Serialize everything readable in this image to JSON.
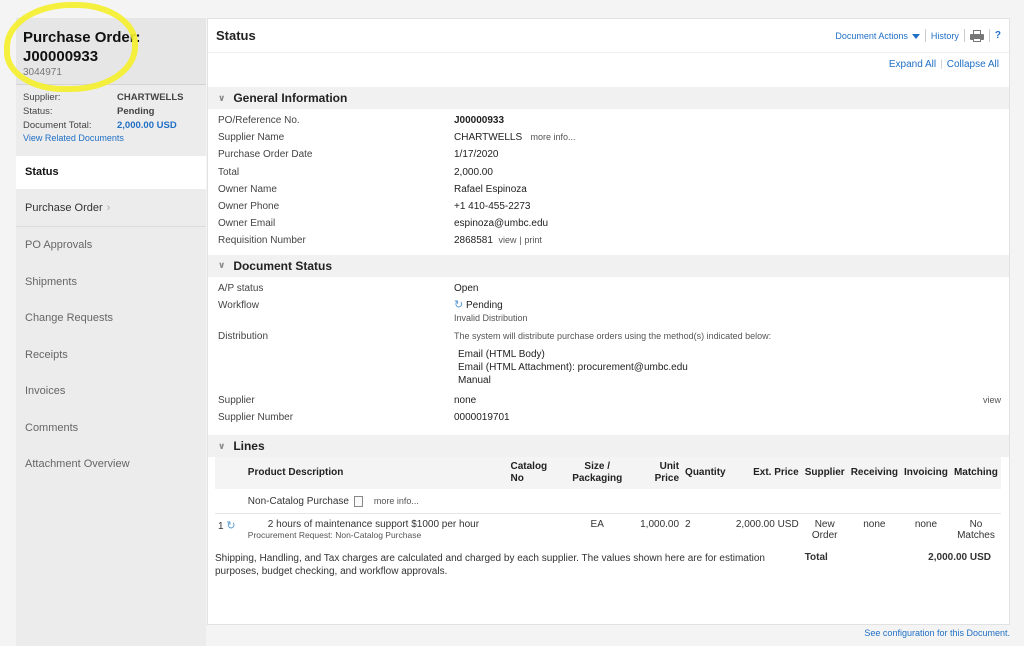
{
  "sidebar": {
    "title_line1": "Purchase Order:",
    "title_line2": "J00000933",
    "sub_id": "3044971",
    "meta": [
      {
        "key": "Supplier:",
        "value": "CHARTWELLS"
      },
      {
        "key": "Status:",
        "value": "Pending"
      },
      {
        "key": "Document Total:",
        "value": "2,000.00  USD"
      }
    ],
    "related_link": "View Related Documents",
    "nav": [
      {
        "label": "Status"
      },
      {
        "label": "Purchase Order"
      },
      {
        "label": "PO Approvals"
      },
      {
        "label": "Shipments"
      },
      {
        "label": "Change Requests"
      },
      {
        "label": "Receipts"
      },
      {
        "label": "Invoices"
      },
      {
        "label": "Comments"
      },
      {
        "label": "Attachment Overview"
      }
    ]
  },
  "header": {
    "title": "Status",
    "document_actions": "Document Actions",
    "history": "History",
    "help": "?",
    "expand_all": "Expand All",
    "collapse_all": "Collapse All"
  },
  "general": {
    "title": "General Information",
    "rows": [
      {
        "key": "PO/Reference No.",
        "value": "J00000933"
      },
      {
        "key": "Supplier Name",
        "value": "CHARTWELLS",
        "link": "more info..."
      },
      {
        "key": "Purchase Order Date",
        "value": "1/17/2020"
      },
      {
        "key": "Total",
        "value": "2,000.00"
      },
      {
        "key": "Owner Name",
        "value": "Rafael Espinoza"
      },
      {
        "key": "Owner Phone",
        "value": "+1 410-455-2273"
      },
      {
        "key": "Owner Email",
        "value": "espinoza@umbc.edu"
      },
      {
        "key": "Requisition Number",
        "value": "2868581",
        "link": "view",
        "link2": "print"
      }
    ]
  },
  "docstatus": {
    "title": "Document Status",
    "ap_key": "A/P status",
    "ap_value": "Open",
    "workflow_key": "Workflow",
    "workflow_value": "Pending",
    "workflow_note": "Invalid Distribution",
    "distribution_key": "Distribution",
    "distribution_intro": "The system will distribute purchase orders using the method(s) indicated below:",
    "distribution_methods": [
      "Email (HTML Body)",
      "Email (HTML Attachment): procurement@umbc.edu",
      "Manual"
    ],
    "supplier_key": "Supplier",
    "supplier_value": "none",
    "supplier_link": "view",
    "supplier_number_key": "Supplier Number",
    "supplier_number_value": "0000019701"
  },
  "lines": {
    "title": "Lines",
    "headers": {
      "product": "Product Description",
      "catalog": "Catalog No",
      "size": "Size / Packaging",
      "unit_price": "Unit Price",
      "quantity": "Quantity",
      "ext_price": "Ext. Price",
      "supplier": "Supplier",
      "receiving": "Receiving",
      "invoicing": "Invoicing",
      "matching": "Matching"
    },
    "group_label": "Non-Catalog Purchase",
    "group_link": "more info...",
    "row": {
      "num": "1",
      "description": "2 hours of maintenance support $1000 per hour",
      "source_link": "Procurement Request: Non-Catalog Purchase",
      "size": "EA",
      "unit_price": "1,000.00",
      "quantity": "2",
      "ext_price": "2,000.00 USD",
      "supplier": "New Order",
      "receiving": "none",
      "invoicing": "none",
      "matching": "No Matches"
    },
    "footer_note": "Shipping, Handling, and Tax charges are calculated and charged by each supplier. The values shown here are for estimation purposes, budget checking, and workflow approvals.",
    "total_label": "Total",
    "total_value": "2,000.00 USD"
  },
  "footer": {
    "config_link": "See configuration for this Document."
  },
  "colors": {
    "link": "#1f6fc5",
    "highlight": "#f5ee2a"
  }
}
